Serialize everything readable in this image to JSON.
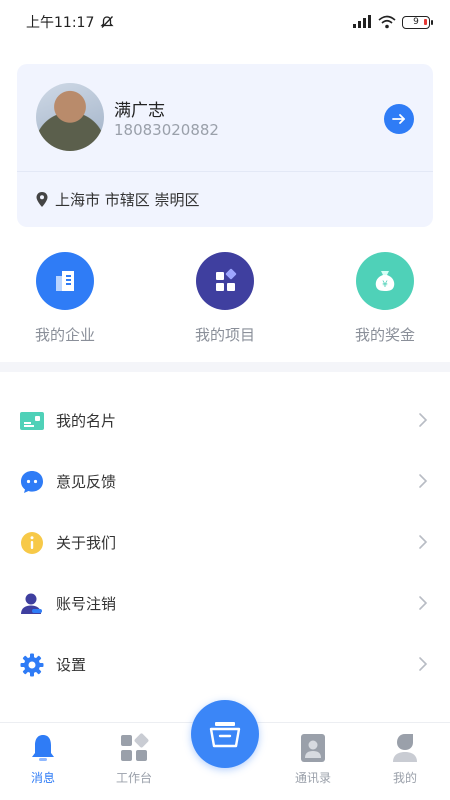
{
  "status_bar": {
    "time": "上午11:17",
    "battery": "9"
  },
  "profile": {
    "name": "满广志",
    "phone": "18083020882",
    "location": "上海市 市辖区 崇明区"
  },
  "quick_actions": [
    {
      "label": "我的企业",
      "icon": "building-icon",
      "color": "#2f7cf6"
    },
    {
      "label": "我的项目",
      "icon": "grid-diamond-icon",
      "color": "#3f3f9f"
    },
    {
      "label": "我的奖金",
      "icon": "money-bag-icon",
      "color": "#4fd1b8"
    }
  ],
  "menu": [
    {
      "label": "我的名片",
      "icon": "business-card-icon",
      "color": "#4fd1b8"
    },
    {
      "label": "意见反馈",
      "icon": "chat-bubble-icon",
      "color": "#2f7cf6"
    },
    {
      "label": "关于我们",
      "icon": "info-icon",
      "color": "#f7c948"
    },
    {
      "label": "账号注销",
      "icon": "user-icon",
      "color": "#3f3f9f"
    },
    {
      "label": "设置",
      "icon": "gear-icon",
      "color": "#2f7cf6"
    }
  ],
  "tab_bar": [
    {
      "label": "消息",
      "icon": "bell-icon",
      "active": true
    },
    {
      "label": "工作台",
      "icon": "apps-icon",
      "active": false
    },
    {
      "label": "通讯录",
      "icon": "contacts-icon",
      "active": false
    },
    {
      "label": "我的",
      "icon": "profile-icon",
      "active": false
    }
  ],
  "colors": {
    "accent": "#2f7cf6",
    "card_bg": "#f1f4fe"
  }
}
